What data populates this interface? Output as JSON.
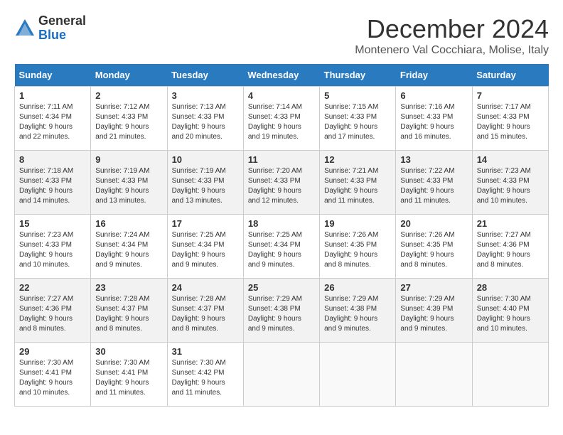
{
  "header": {
    "logo": {
      "general": "General",
      "blue": "Blue"
    },
    "title": "December 2024",
    "location": "Montenero Val Cocchiara, Molise, Italy"
  },
  "columns": [
    "Sunday",
    "Monday",
    "Tuesday",
    "Wednesday",
    "Thursday",
    "Friday",
    "Saturday"
  ],
  "weeks": [
    [
      {
        "day": "1",
        "sunrise": "Sunrise: 7:11 AM",
        "sunset": "Sunset: 4:34 PM",
        "daylight": "Daylight: 9 hours and 22 minutes."
      },
      {
        "day": "2",
        "sunrise": "Sunrise: 7:12 AM",
        "sunset": "Sunset: 4:33 PM",
        "daylight": "Daylight: 9 hours and 21 minutes."
      },
      {
        "day": "3",
        "sunrise": "Sunrise: 7:13 AM",
        "sunset": "Sunset: 4:33 PM",
        "daylight": "Daylight: 9 hours and 20 minutes."
      },
      {
        "day": "4",
        "sunrise": "Sunrise: 7:14 AM",
        "sunset": "Sunset: 4:33 PM",
        "daylight": "Daylight: 9 hours and 19 minutes."
      },
      {
        "day": "5",
        "sunrise": "Sunrise: 7:15 AM",
        "sunset": "Sunset: 4:33 PM",
        "daylight": "Daylight: 9 hours and 17 minutes."
      },
      {
        "day": "6",
        "sunrise": "Sunrise: 7:16 AM",
        "sunset": "Sunset: 4:33 PM",
        "daylight": "Daylight: 9 hours and 16 minutes."
      },
      {
        "day": "7",
        "sunrise": "Sunrise: 7:17 AM",
        "sunset": "Sunset: 4:33 PM",
        "daylight": "Daylight: 9 hours and 15 minutes."
      }
    ],
    [
      {
        "day": "8",
        "sunrise": "Sunrise: 7:18 AM",
        "sunset": "Sunset: 4:33 PM",
        "daylight": "Daylight: 9 hours and 14 minutes."
      },
      {
        "day": "9",
        "sunrise": "Sunrise: 7:19 AM",
        "sunset": "Sunset: 4:33 PM",
        "daylight": "Daylight: 9 hours and 13 minutes."
      },
      {
        "day": "10",
        "sunrise": "Sunrise: 7:19 AM",
        "sunset": "Sunset: 4:33 PM",
        "daylight": "Daylight: 9 hours and 13 minutes."
      },
      {
        "day": "11",
        "sunrise": "Sunrise: 7:20 AM",
        "sunset": "Sunset: 4:33 PM",
        "daylight": "Daylight: 9 hours and 12 minutes."
      },
      {
        "day": "12",
        "sunrise": "Sunrise: 7:21 AM",
        "sunset": "Sunset: 4:33 PM",
        "daylight": "Daylight: 9 hours and 11 minutes."
      },
      {
        "day": "13",
        "sunrise": "Sunrise: 7:22 AM",
        "sunset": "Sunset: 4:33 PM",
        "daylight": "Daylight: 9 hours and 11 minutes."
      },
      {
        "day": "14",
        "sunrise": "Sunrise: 7:23 AM",
        "sunset": "Sunset: 4:33 PM",
        "daylight": "Daylight: 9 hours and 10 minutes."
      }
    ],
    [
      {
        "day": "15",
        "sunrise": "Sunrise: 7:23 AM",
        "sunset": "Sunset: 4:33 PM",
        "daylight": "Daylight: 9 hours and 10 minutes."
      },
      {
        "day": "16",
        "sunrise": "Sunrise: 7:24 AM",
        "sunset": "Sunset: 4:34 PM",
        "daylight": "Daylight: 9 hours and 9 minutes."
      },
      {
        "day": "17",
        "sunrise": "Sunrise: 7:25 AM",
        "sunset": "Sunset: 4:34 PM",
        "daylight": "Daylight: 9 hours and 9 minutes."
      },
      {
        "day": "18",
        "sunrise": "Sunrise: 7:25 AM",
        "sunset": "Sunset: 4:34 PM",
        "daylight": "Daylight: 9 hours and 9 minutes."
      },
      {
        "day": "19",
        "sunrise": "Sunrise: 7:26 AM",
        "sunset": "Sunset: 4:35 PM",
        "daylight": "Daylight: 9 hours and 8 minutes."
      },
      {
        "day": "20",
        "sunrise": "Sunrise: 7:26 AM",
        "sunset": "Sunset: 4:35 PM",
        "daylight": "Daylight: 9 hours and 8 minutes."
      },
      {
        "day": "21",
        "sunrise": "Sunrise: 7:27 AM",
        "sunset": "Sunset: 4:36 PM",
        "daylight": "Daylight: 9 hours and 8 minutes."
      }
    ],
    [
      {
        "day": "22",
        "sunrise": "Sunrise: 7:27 AM",
        "sunset": "Sunset: 4:36 PM",
        "daylight": "Daylight: 9 hours and 8 minutes."
      },
      {
        "day": "23",
        "sunrise": "Sunrise: 7:28 AM",
        "sunset": "Sunset: 4:37 PM",
        "daylight": "Daylight: 9 hours and 8 minutes."
      },
      {
        "day": "24",
        "sunrise": "Sunrise: 7:28 AM",
        "sunset": "Sunset: 4:37 PM",
        "daylight": "Daylight: 9 hours and 8 minutes."
      },
      {
        "day": "25",
        "sunrise": "Sunrise: 7:29 AM",
        "sunset": "Sunset: 4:38 PM",
        "daylight": "Daylight: 9 hours and 9 minutes."
      },
      {
        "day": "26",
        "sunrise": "Sunrise: 7:29 AM",
        "sunset": "Sunset: 4:38 PM",
        "daylight": "Daylight: 9 hours and 9 minutes."
      },
      {
        "day": "27",
        "sunrise": "Sunrise: 7:29 AM",
        "sunset": "Sunset: 4:39 PM",
        "daylight": "Daylight: 9 hours and 9 minutes."
      },
      {
        "day": "28",
        "sunrise": "Sunrise: 7:30 AM",
        "sunset": "Sunset: 4:40 PM",
        "daylight": "Daylight: 9 hours and 10 minutes."
      }
    ],
    [
      {
        "day": "29",
        "sunrise": "Sunrise: 7:30 AM",
        "sunset": "Sunset: 4:41 PM",
        "daylight": "Daylight: 9 hours and 10 minutes."
      },
      {
        "day": "30",
        "sunrise": "Sunrise: 7:30 AM",
        "sunset": "Sunset: 4:41 PM",
        "daylight": "Daylight: 9 hours and 11 minutes."
      },
      {
        "day": "31",
        "sunrise": "Sunrise: 7:30 AM",
        "sunset": "Sunset: 4:42 PM",
        "daylight": "Daylight: 9 hours and 11 minutes."
      },
      null,
      null,
      null,
      null
    ]
  ]
}
